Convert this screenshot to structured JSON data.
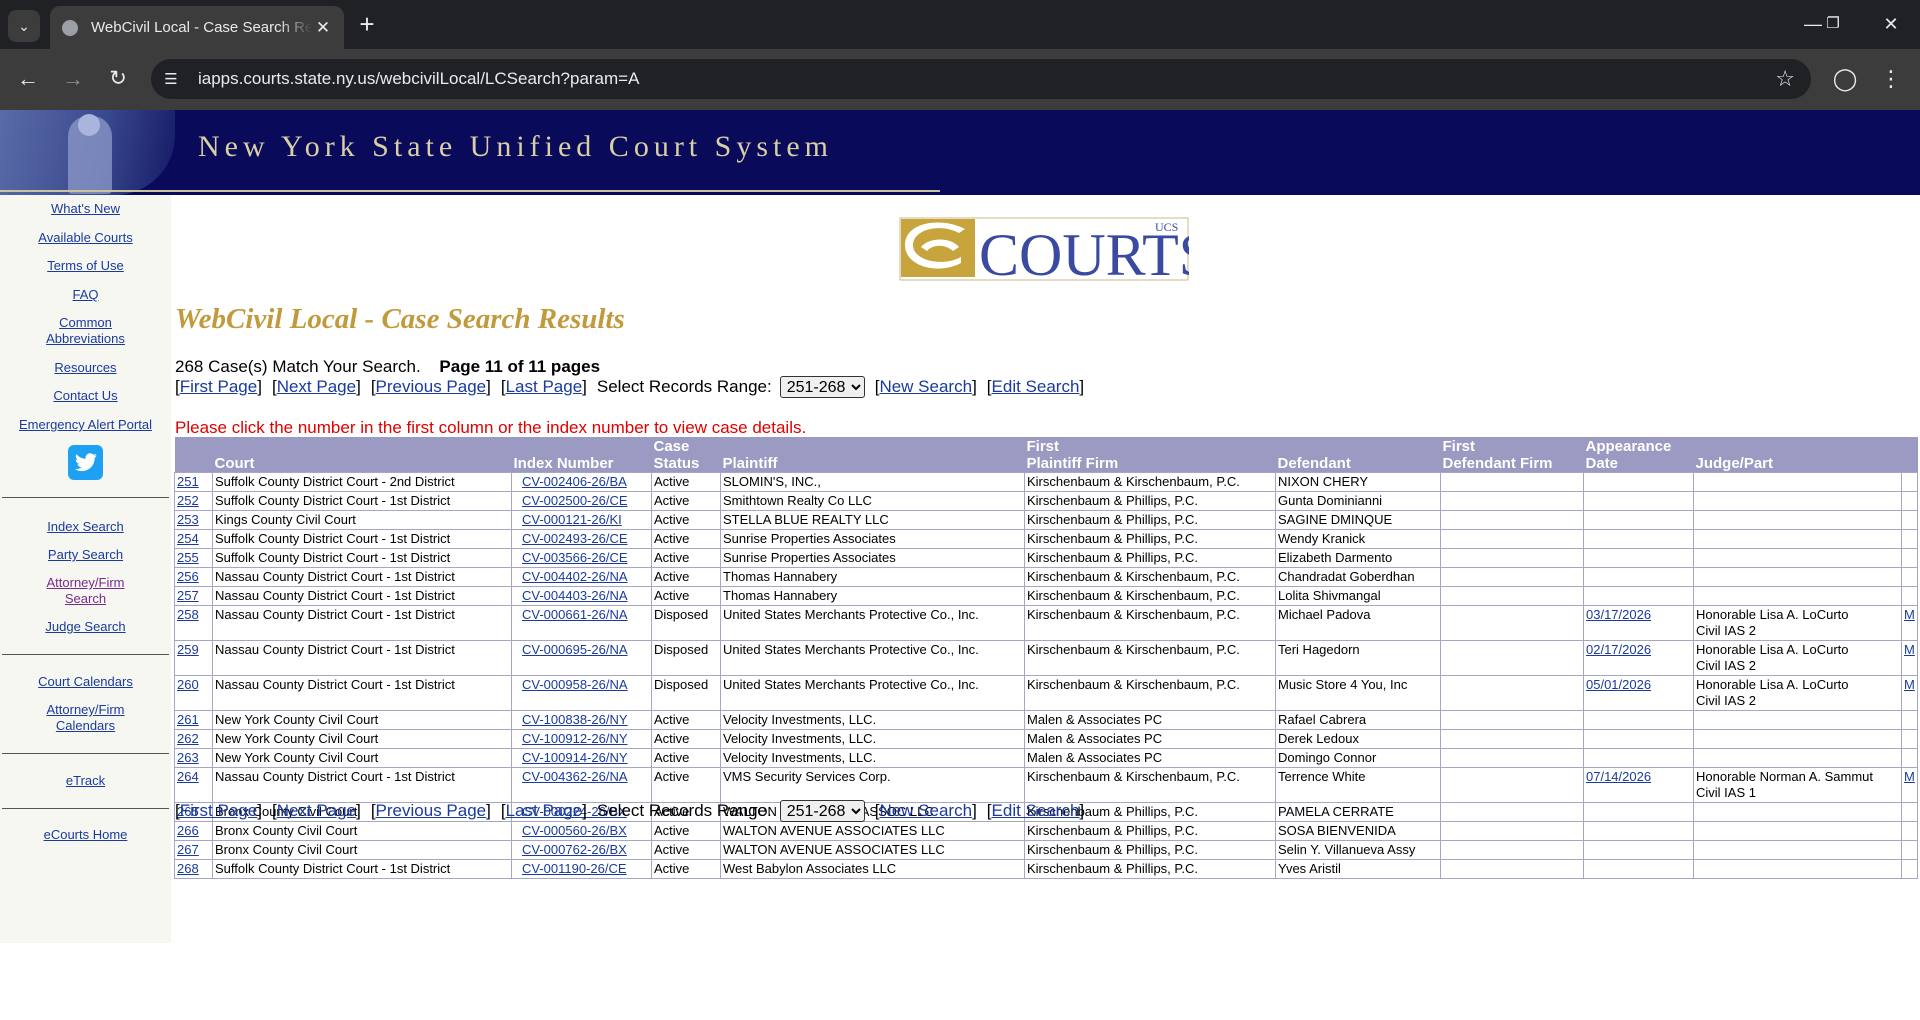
{
  "browser": {
    "tab_title": "WebCivil Local - Case Search Re",
    "url": "iapps.courts.state.ny.us/webcivilLocal/LCSearch?param=A"
  },
  "banner": {
    "title": "New York State Unified Court System"
  },
  "sidebar": {
    "links": [
      "What's New",
      "Available Courts",
      "Terms of Use",
      "FAQ",
      "Common Abbreviations",
      "Resources",
      "Contact Us",
      "Emergency Alert Portal"
    ],
    "search_links": [
      "Index Search",
      "Party Search",
      "Attorney/Firm Search",
      "Judge Search"
    ],
    "calendar_links": [
      "Court Calendars",
      "Attorney/Firm Calendars"
    ],
    "etrack": "eTrack",
    "ecourts_home": "eCourts Home"
  },
  "logo": {
    "text": "COURTS",
    "superscript": "UCS"
  },
  "page": {
    "heading": "WebCivil Local - Case Search Results",
    "match_text": "268 Case(s) Match Your Search.",
    "page_text": "Page 11 of 11 pages",
    "nav": {
      "first": "First Page",
      "next": "Next Page",
      "previous": "Previous Page",
      "last": "Last Page",
      "range_label": "Select Records Range:",
      "range_value": "251-268",
      "new_search": "New Search",
      "edit_search": "Edit Search"
    },
    "notice": "Please click the number in the first column or the index number to view case details."
  },
  "table": {
    "headers": {
      "court": "Court",
      "index_number": "Index Number",
      "case_status_1": "Case",
      "case_status_2": "Status",
      "plaintiff": "Plaintiff",
      "plaintiff_firm_1": "First",
      "plaintiff_firm_2": "Plaintiff Firm",
      "defendant": "Defendant",
      "defendant_firm_1": "First",
      "defendant_firm_2": "Defendant Firm",
      "appearance_1": "Appearance",
      "appearance_2": "Date",
      "judge": "Judge/Part"
    },
    "rows": [
      {
        "num": "251",
        "court": "Suffolk County District Court - 2nd District",
        "index": "CV-002406-26/BA",
        "status": "Active",
        "plaintiff": "SLOMIN'S, INC.,",
        "pfirm": "Kirschenbaum & Kirschenbaum, P.C.",
        "defendant": "NIXON CHERY",
        "dfirm": "",
        "date": "",
        "judge": "",
        "judge2": "",
        "m": ""
      },
      {
        "num": "252",
        "court": "Suffolk County District Court - 1st District",
        "index": "CV-002500-26/CE",
        "status": "Active",
        "plaintiff": "Smithtown Realty Co LLC",
        "pfirm": "Kirschenbaum & Phillips, P.C.",
        "defendant": "Gunta Dominianni",
        "dfirm": "",
        "date": "",
        "judge": "",
        "judge2": "",
        "m": ""
      },
      {
        "num": "253",
        "court": "Kings County Civil Court",
        "index": "CV-000121-26/KI",
        "status": "Active",
        "plaintiff": "STELLA BLUE REALTY LLC",
        "pfirm": "Kirschenbaum & Phillips, P.C.",
        "defendant": "SAGINE DMINQUE",
        "dfirm": "",
        "date": "",
        "judge": "",
        "judge2": "",
        "m": ""
      },
      {
        "num": "254",
        "court": "Suffolk County District Court - 1st District",
        "index": "CV-002493-26/CE",
        "status": "Active",
        "plaintiff": "Sunrise Properties Associates",
        "pfirm": "Kirschenbaum & Phillips, P.C.",
        "defendant": "Wendy Kranick",
        "dfirm": "",
        "date": "",
        "judge": "",
        "judge2": "",
        "m": ""
      },
      {
        "num": "255",
        "court": "Suffolk County District Court - 1st District",
        "index": "CV-003566-26/CE",
        "status": "Active",
        "plaintiff": "Sunrise Properties Associates",
        "pfirm": "Kirschenbaum & Phillips, P.C.",
        "defendant": "Elizabeth Darmento",
        "dfirm": "",
        "date": "",
        "judge": "",
        "judge2": "",
        "m": ""
      },
      {
        "num": "256",
        "court": "Nassau County District Court - 1st District",
        "index": "CV-004402-26/NA",
        "status": "Active",
        "plaintiff": "Thomas Hannabery",
        "pfirm": "Kirschenbaum & Kirschenbaum, P.C.",
        "defendant": "Chandradat Goberdhan",
        "dfirm": "",
        "date": "",
        "judge": "",
        "judge2": "",
        "m": ""
      },
      {
        "num": "257",
        "court": "Nassau County District Court - 1st District",
        "index": "CV-004403-26/NA",
        "status": "Active",
        "plaintiff": "Thomas Hannabery",
        "pfirm": "Kirschenbaum & Kirschenbaum, P.C.",
        "defendant": "Lolita Shivmangal",
        "dfirm": "",
        "date": "",
        "judge": "",
        "judge2": "",
        "m": ""
      },
      {
        "num": "258",
        "court": "Nassau County District Court - 1st District",
        "index": "CV-000661-26/NA",
        "status": "Disposed",
        "plaintiff": "United States Merchants Protective Co., Inc.",
        "pfirm": "Kirschenbaum & Kirschenbaum, P.C.",
        "defendant": "Michael Padova",
        "dfirm": "",
        "date": "03/17/2026",
        "judge": "Honorable Lisa A. LoCurto",
        "judge2": "Civil IAS 2",
        "m": "M"
      },
      {
        "num": "259",
        "court": "Nassau County District Court - 1st District",
        "index": "CV-000695-26/NA",
        "status": "Disposed",
        "plaintiff": "United States Merchants Protective Co., Inc.",
        "pfirm": "Kirschenbaum & Kirschenbaum, P.C.",
        "defendant": "Teri Hagedorn",
        "dfirm": "",
        "date": "02/17/2026",
        "judge": "Honorable Lisa A. LoCurto",
        "judge2": "Civil IAS 2",
        "m": "M"
      },
      {
        "num": "260",
        "court": "Nassau County District Court - 1st District",
        "index": "CV-000958-26/NA",
        "status": "Disposed",
        "plaintiff": "United States Merchants Protective Co., Inc.",
        "pfirm": "Kirschenbaum & Kirschenbaum, P.C.",
        "defendant": "Music Store 4 You, Inc",
        "dfirm": "",
        "date": "05/01/2026",
        "judge": "Honorable Lisa A. LoCurto",
        "judge2": "Civil IAS 2",
        "m": "M"
      },
      {
        "num": "261",
        "court": "New York County Civil Court",
        "index": "CV-100838-26/NY",
        "status": "Active",
        "plaintiff": "Velocity Investments, LLC.",
        "pfirm": "Malen & Associates PC",
        "defendant": "Rafael Cabrera",
        "dfirm": "",
        "date": "",
        "judge": "",
        "judge2": "",
        "m": ""
      },
      {
        "num": "262",
        "court": "New York County Civil Court",
        "index": "CV-100912-26/NY",
        "status": "Active",
        "plaintiff": "Velocity Investments, LLC.",
        "pfirm": "Malen & Associates PC",
        "defendant": "Derek Ledoux",
        "dfirm": "",
        "date": "",
        "judge": "",
        "judge2": "",
        "m": ""
      },
      {
        "num": "263",
        "court": "New York County Civil Court",
        "index": "CV-100914-26/NY",
        "status": "Active",
        "plaintiff": "Velocity Investments, LLC.",
        "pfirm": "Malen & Associates PC",
        "defendant": "Domingo Connor",
        "dfirm": "",
        "date": "",
        "judge": "",
        "judge2": "",
        "m": ""
      },
      {
        "num": "264",
        "court": "Nassau County District Court - 1st District",
        "index": "CV-004362-26/NA",
        "status": "Active",
        "plaintiff": "VMS Security Services Corp.",
        "pfirm": "Kirschenbaum & Kirschenbaum, P.C.",
        "defendant": "Terrence White",
        "dfirm": "",
        "date": "07/14/2026",
        "judge": "Honorable Norman A. Sammut",
        "judge2": "Civil IAS 1",
        "m": "M"
      },
      {
        "num": "265",
        "court": "Bronx County Civil Court",
        "index": "CV-000224-26/BX",
        "status": "Active",
        "plaintiff": "WALTON AVE REALTY ASSOC LLC",
        "pfirm": "Kirschenbaum & Phillips, P.C.",
        "defendant": "PAMELA CERRATE",
        "dfirm": "",
        "date": "",
        "judge": "",
        "judge2": "",
        "m": ""
      },
      {
        "num": "266",
        "court": "Bronx County Civil Court",
        "index": "CV-000560-26/BX",
        "status": "Active",
        "plaintiff": "WALTON AVENUE ASSOCIATES LLC",
        "pfirm": "Kirschenbaum & Phillips, P.C.",
        "defendant": "SOSA BIENVENIDA",
        "dfirm": "",
        "date": "",
        "judge": "",
        "judge2": "",
        "m": ""
      },
      {
        "num": "267",
        "court": "Bronx County Civil Court",
        "index": "CV-000762-26/BX",
        "status": "Active",
        "plaintiff": "WALTON AVENUE ASSOCIATES LLC",
        "pfirm": "Kirschenbaum & Phillips, P.C.",
        "defendant": "Selin Y. Villanueva Assy",
        "dfirm": "",
        "date": "",
        "judge": "",
        "judge2": "",
        "m": ""
      },
      {
        "num": "268",
        "court": "Suffolk County District Court - 1st District",
        "index": "CV-001190-26/CE",
        "status": "Active",
        "plaintiff": "West Babylon Associates LLC",
        "pfirm": "Kirschenbaum & Phillips, P.C.",
        "defendant": "Yves Aristil",
        "dfirm": "",
        "date": "",
        "judge": "",
        "judge2": "",
        "m": ""
      }
    ]
  },
  "colors": {
    "banner_bg": "#0a0a5a",
    "header_bg": "#9a9ac2",
    "heading_gold": "#c19a3c",
    "link_blue": "#1a3a9e",
    "notice_red": "#e00000",
    "sidebar_bg": "#f7f7f2"
  }
}
